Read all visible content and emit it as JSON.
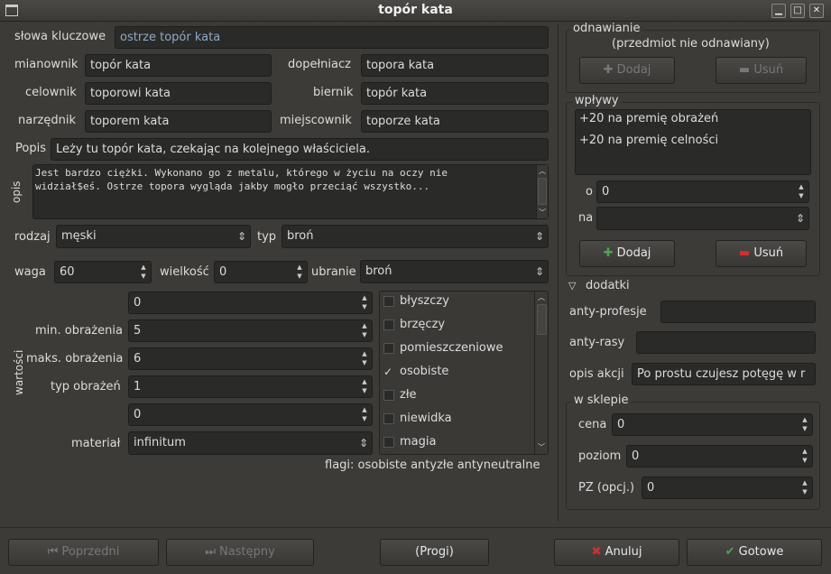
{
  "window": {
    "title": "topór kata",
    "min": "▁",
    "max": "□",
    "close": "✕"
  },
  "main": {
    "keywords_label": "słowa kluczowe",
    "keywords": "ostrze topór kata",
    "mianownik_label": "mianownik",
    "mianownik": "topór kata",
    "dopelniacz_label": "dopełniacz",
    "dopelniacz": "topora kata",
    "celownik_label": "celownik",
    "celownik": "toporowi kata",
    "biernik_label": "biernik",
    "biernik": "topór kata",
    "narzednik_label": "narzędnik",
    "narzednik": "toporem kata",
    "miejscownik_label": "miejscownik",
    "miejscownik": "toporze kata",
    "popis_label": "Popis",
    "popis": "Leży tu topór kata, czekając na kolejnego właściciela.",
    "opis_label": "opis",
    "opis_line1": "Jest bardzo ciężki. Wykonano go z metalu, którego w życiu na oczy nie",
    "opis_line2": "widział$eś. Ostrze topora wygląda jakby mogło przeciąć wszystko...",
    "rodzaj_label": "rodzaj",
    "rodzaj": "męski",
    "typ_label": "typ",
    "typ": "broń",
    "waga_label": "waga",
    "waga": "60",
    "wielkosc_label": "wielkość",
    "wielkosc": "0",
    "ubranie_label": "ubranie",
    "ubranie": "broń",
    "wartosci_label": "wartości",
    "val0": "0",
    "min_label": "min. obrażenia",
    "min": "5",
    "maks_label": "maks. obrażenia",
    "maks": "6",
    "typobr_label": "typ obrażeń",
    "typobr": "1",
    "val4": "0",
    "material_label": "materiał",
    "material": "infinitum",
    "flags": [
      {
        "label": "błyszczy",
        "checked": false
      },
      {
        "label": "brzęczy",
        "checked": false
      },
      {
        "label": "pomieszczeniowe",
        "checked": false
      },
      {
        "label": "osobiste",
        "checked": true
      },
      {
        "label": "złe",
        "checked": false
      },
      {
        "label": "niewidka",
        "checked": false
      },
      {
        "label": "magia",
        "checked": false
      }
    ],
    "check_mark": "✓",
    "flags_summary": "flagi: osobiste antyzłe antyneutralne"
  },
  "right": {
    "odnawianie_label": "odnawianie",
    "odnawianie_text": "(przedmiot nie odnawiany)",
    "add_label": "Dodaj",
    "remove_label": "Usuń",
    "wplywy_label": "wpływy",
    "wplywy": [
      "+20 na premię obrażeń",
      "+20 na premię celności"
    ],
    "o_label": "o",
    "o": "0",
    "na_label": "na",
    "na": "",
    "dodatki_label": "dodatki",
    "anty_profesje_label": "anty-profesje",
    "anty_profesje": "",
    "anty_rasy_label": "anty-rasy",
    "anty_rasy": "",
    "opis_akcji_label": "opis akcji",
    "opis_akcji": "Po prostu czujesz potęgę w r",
    "sklep_label": "w sklepie",
    "cena_label": "cena",
    "cena": "0",
    "poziom_label": "poziom",
    "poziom": "0",
    "pz_label": "PZ (opcj.)",
    "pz": "0"
  },
  "footer": {
    "prev": "Poprzedni",
    "next": "Następny",
    "progi": "(Progi)",
    "cancel": "Anuluj",
    "ok": "Gotowe"
  },
  "colors": {
    "accent_add": "#4ca64c",
    "accent_remove": "#d03030"
  }
}
